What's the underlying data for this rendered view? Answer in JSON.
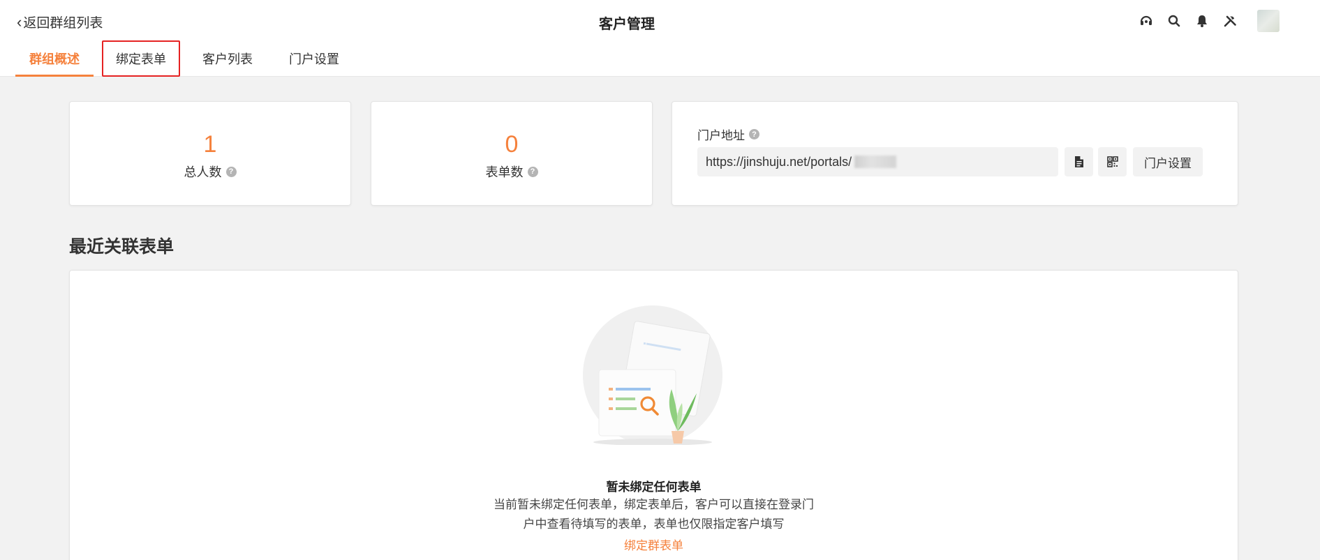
{
  "header": {
    "back_label": "返回群组列表",
    "title": "客户管理",
    "icons": [
      "headset-icon",
      "search-icon",
      "bell-icon",
      "tools-icon",
      "avatar"
    ]
  },
  "tabs": [
    {
      "label": "群组概述",
      "active": true
    },
    {
      "label": "绑定表单",
      "active": false,
      "highlighted": true
    },
    {
      "label": "客户列表",
      "active": false
    },
    {
      "label": "门户设置",
      "active": false
    }
  ],
  "stats": {
    "total_people": {
      "value": "1",
      "label": "总人数"
    },
    "form_count": {
      "value": "0",
      "label": "表单数"
    }
  },
  "portal": {
    "label": "门户地址",
    "url": "https://jinshuju.net/portals/",
    "settings_button": "门户设置"
  },
  "recent": {
    "section_title": "最近关联表单",
    "empty_title": "暂未绑定任何表单",
    "empty_desc_line1": "当前暂未绑定任何表单，绑定表单后，客户可以直接在登录门",
    "empty_desc_line2": "户中查看待填写的表单，表单也仅限指定客户填写",
    "bind_link": "绑定群表单"
  },
  "colors": {
    "accent": "#f5813c",
    "highlight_box": "#e52222",
    "background": "#f2f2f2"
  }
}
